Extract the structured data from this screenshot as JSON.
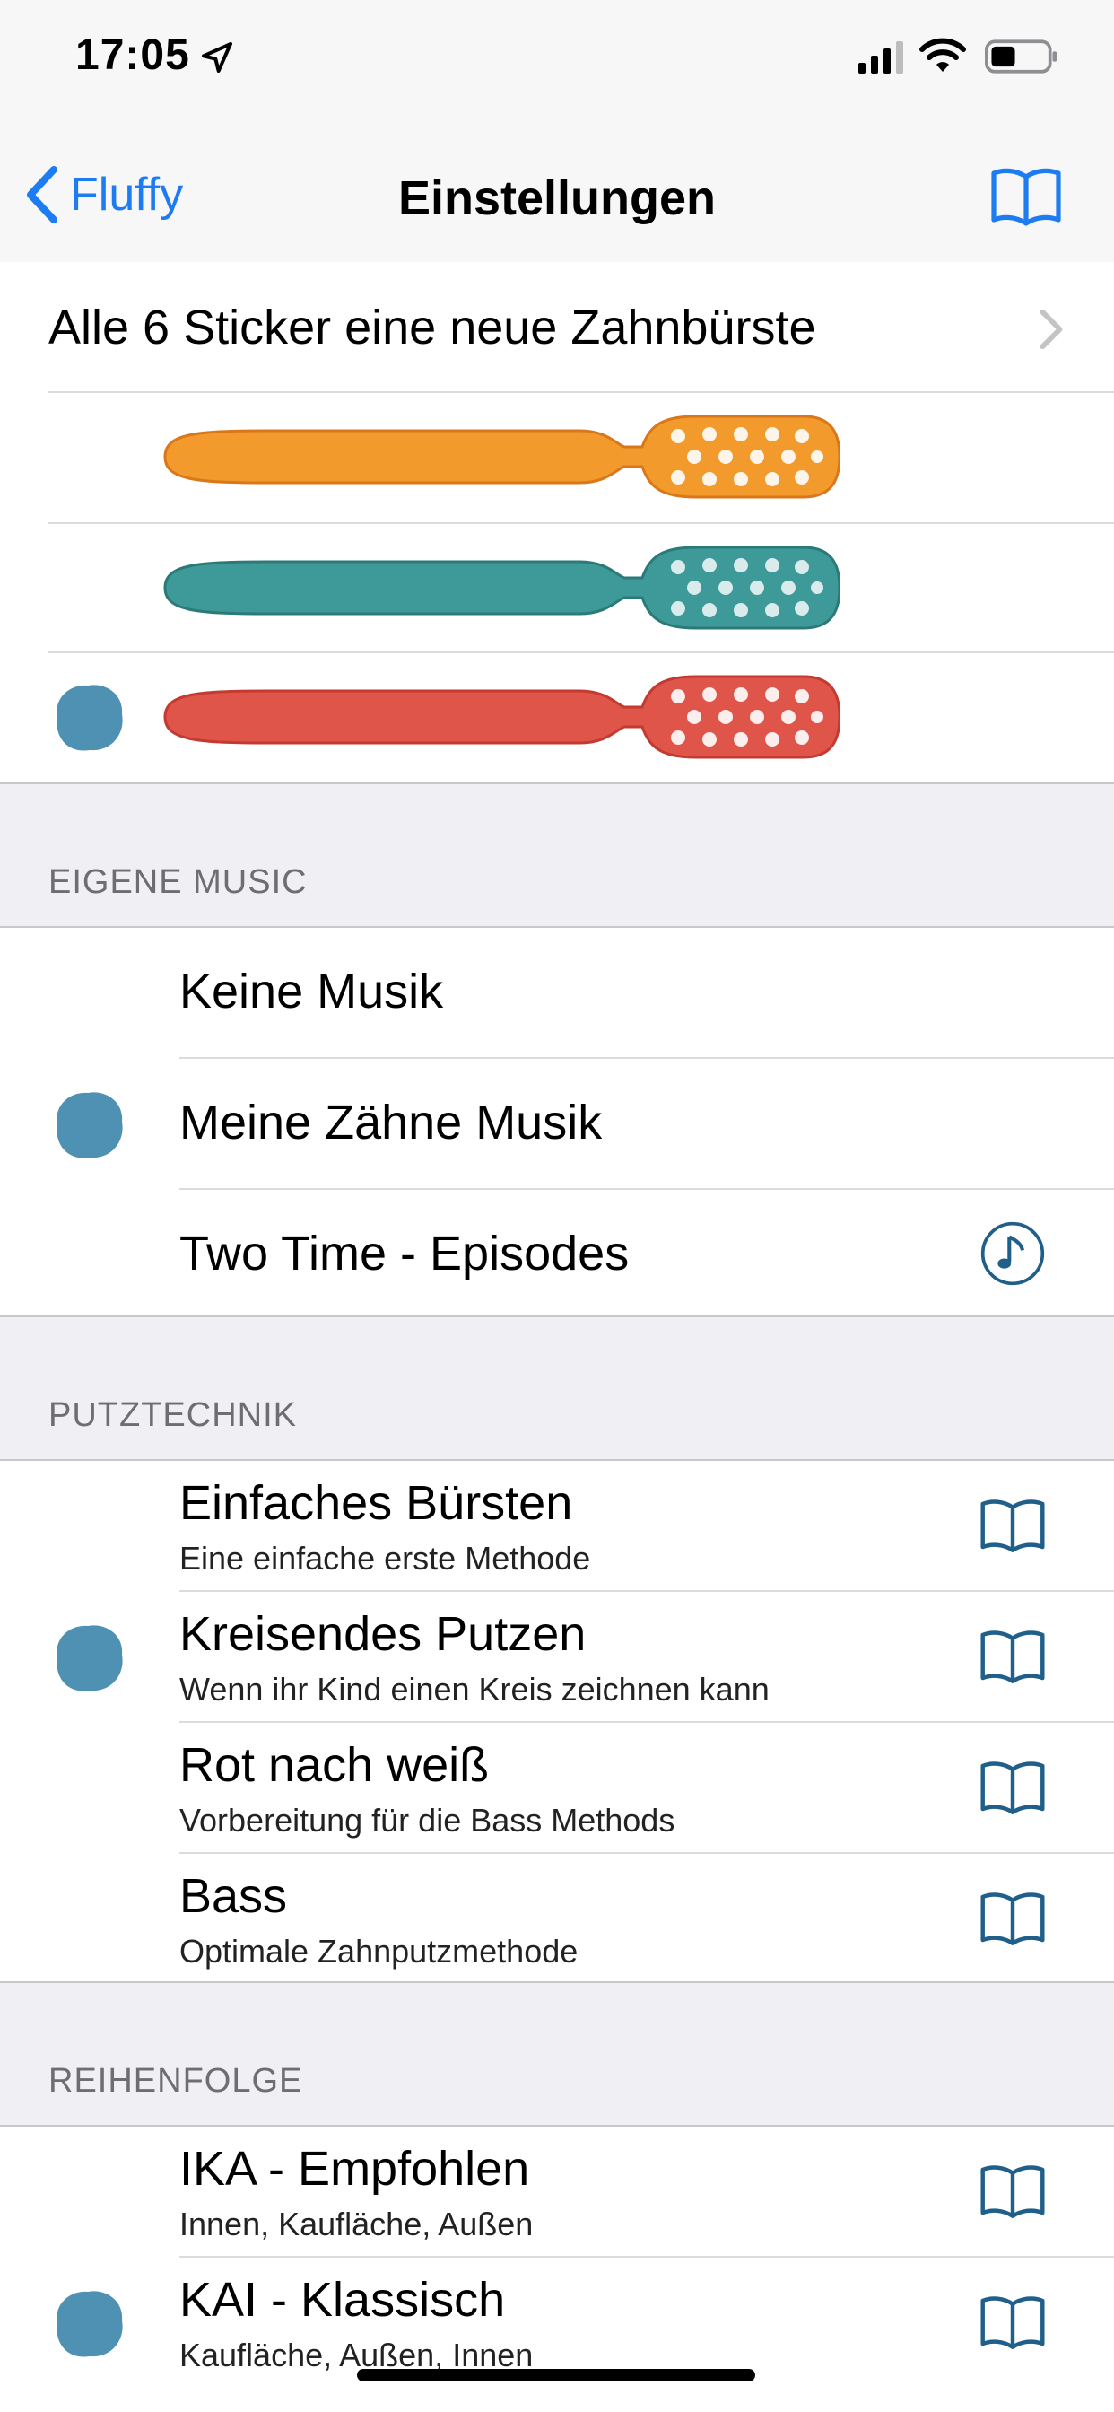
{
  "status_bar": {
    "time": "17:05"
  },
  "nav": {
    "back_label": "Fluffy",
    "title": "Einstellungen"
  },
  "sticker_row": {
    "label": "Alle 6 Sticker eine neue Zahnbürste"
  },
  "toothbrushes": [
    {
      "name": "orange",
      "color": "#f39a2c",
      "selected": false
    },
    {
      "name": "teal",
      "color": "#3e9a98",
      "selected": false
    },
    {
      "name": "red",
      "color": "#e0554a",
      "selected": true
    }
  ],
  "music_section": {
    "header": "EIGENE MUSIC",
    "items": [
      {
        "label": "Keine Musik",
        "selected": false
      },
      {
        "label": "Meine Zähne Musik",
        "selected": true
      },
      {
        "label": "Two Time - Episodes",
        "selected": false,
        "icon": "music-note-icon"
      }
    ]
  },
  "technique_section": {
    "header": "PUTZTECHNIK",
    "items": [
      {
        "title": "Einfaches Bürsten",
        "subtitle": "Eine einfache erste Methode",
        "selected": false
      },
      {
        "title": "Kreisendes Putzen",
        "subtitle": "Wenn ihr Kind einen Kreis zeichnen kann",
        "selected": true
      },
      {
        "title": "Rot nach weiß",
        "subtitle": "Vorbereitung für die Bass Methods",
        "selected": false
      },
      {
        "title": "Bass",
        "subtitle": "Optimale Zahnputzmethode",
        "selected": false
      }
    ]
  },
  "order_section": {
    "header": "REIHENFOLGE",
    "items": [
      {
        "title": "IKA - Empfohlen",
        "subtitle": "Innen, Kaufläche, Außen",
        "selected": false
      },
      {
        "title": "KAI - Klassisch",
        "subtitle": "Kaufläche, Außen, Innen",
        "selected": true
      }
    ]
  },
  "colors": {
    "accent": "#1e7cf2",
    "icon_blue": "#1f5f8a",
    "blob": "#2f7ea6"
  }
}
